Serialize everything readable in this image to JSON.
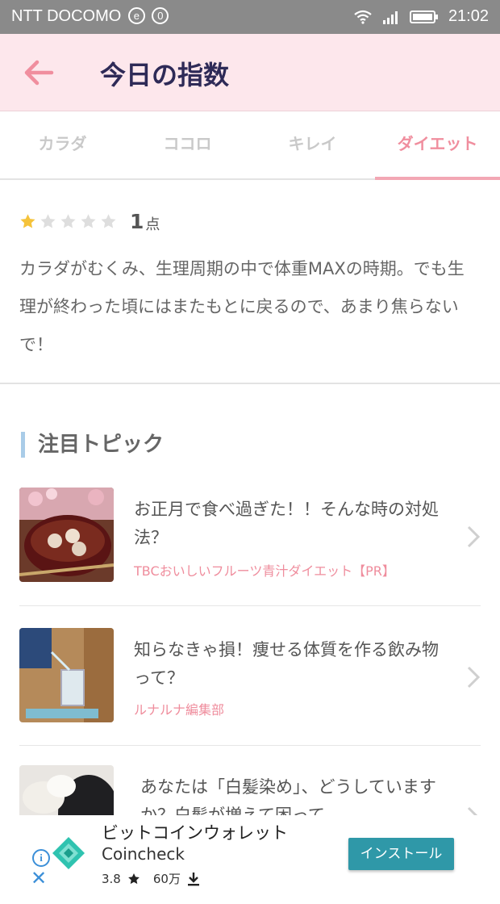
{
  "status_bar": {
    "carrier": "NTT DOCOMO",
    "badge_e": "e",
    "badge_0": "0",
    "time": "21:02"
  },
  "header": {
    "title": "今日の指数"
  },
  "tabs": [
    {
      "label": "カラダ",
      "active": false
    },
    {
      "label": "ココロ",
      "active": false
    },
    {
      "label": "キレイ",
      "active": false
    },
    {
      "label": "ダイエット",
      "active": true
    }
  ],
  "rating": {
    "score": "1",
    "unit": "点",
    "stars_filled": 1,
    "stars_total": 5
  },
  "description": "カラダがむくみ、生理周期の中で体重MAXの時期。でも生理が終わった頃にはまたもとに戻るので、あまり焦らないで！",
  "topics": {
    "heading": "注目トピック",
    "items": [
      {
        "title": "お正月で食べ過ぎた！！そんな時の対処法？",
        "source": "TBCおいしいフルーツ青汁ダイエット【PR】"
      },
      {
        "title": "知らなきゃ損！痩せる体質を作る飲み物って？",
        "source": "ルナルナ編集部"
      },
      {
        "title": "あなたは「白髪染め」、どうしていますか？白髪が増えて困って…",
        "source": ""
      }
    ]
  },
  "ad": {
    "title": "ビットコインウォレット",
    "name": "Coincheck",
    "rating": "3.8",
    "downloads": "60万",
    "install_label": "インストール",
    "info_label": "i",
    "close_label": "✕"
  },
  "colors": {
    "header_bg": "#fde7ec",
    "accent_pink": "#f08e9e",
    "title_navy": "#2e2a57",
    "install_teal": "#2f98a8"
  }
}
